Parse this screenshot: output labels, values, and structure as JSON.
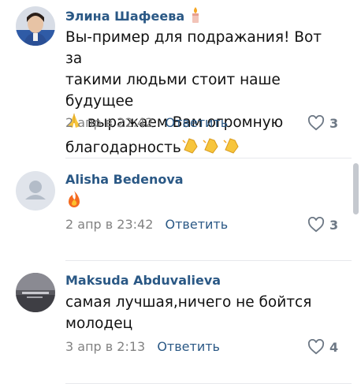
{
  "comments": [
    {
      "author": "Элина Шафеева",
      "text_line1": "Вы-пример для подражания! Вот за",
      "text_line2": "такими людьми стоит наше будущее",
      "text_line3": "выражаем Вам огромную",
      "text_line4": "благодарность",
      "date": "2 апр в 22:42",
      "reply": "Ответить",
      "likes": "3",
      "avatar": "user-photo",
      "emoji": [
        "candle",
        "folded-hands",
        "clapping-hands"
      ]
    },
    {
      "author": "Alisha Bedenova",
      "date": "2 апр в 23:42",
      "reply": "Ответить",
      "likes": "3",
      "avatar": "default-avatar",
      "emoji": [
        "fire"
      ]
    },
    {
      "author": "Maksuda Abduvalieva",
      "text_line1": "самая лучшая,ничего не бойтся",
      "text_line2": "молодец",
      "date": "3 апр в 2:13",
      "reply": "Ответить",
      "likes": "4",
      "avatar": "dark-photo"
    }
  ],
  "colors": {
    "author": "#2a5885",
    "meta": "#828282",
    "divider": "#e7e8ec"
  }
}
